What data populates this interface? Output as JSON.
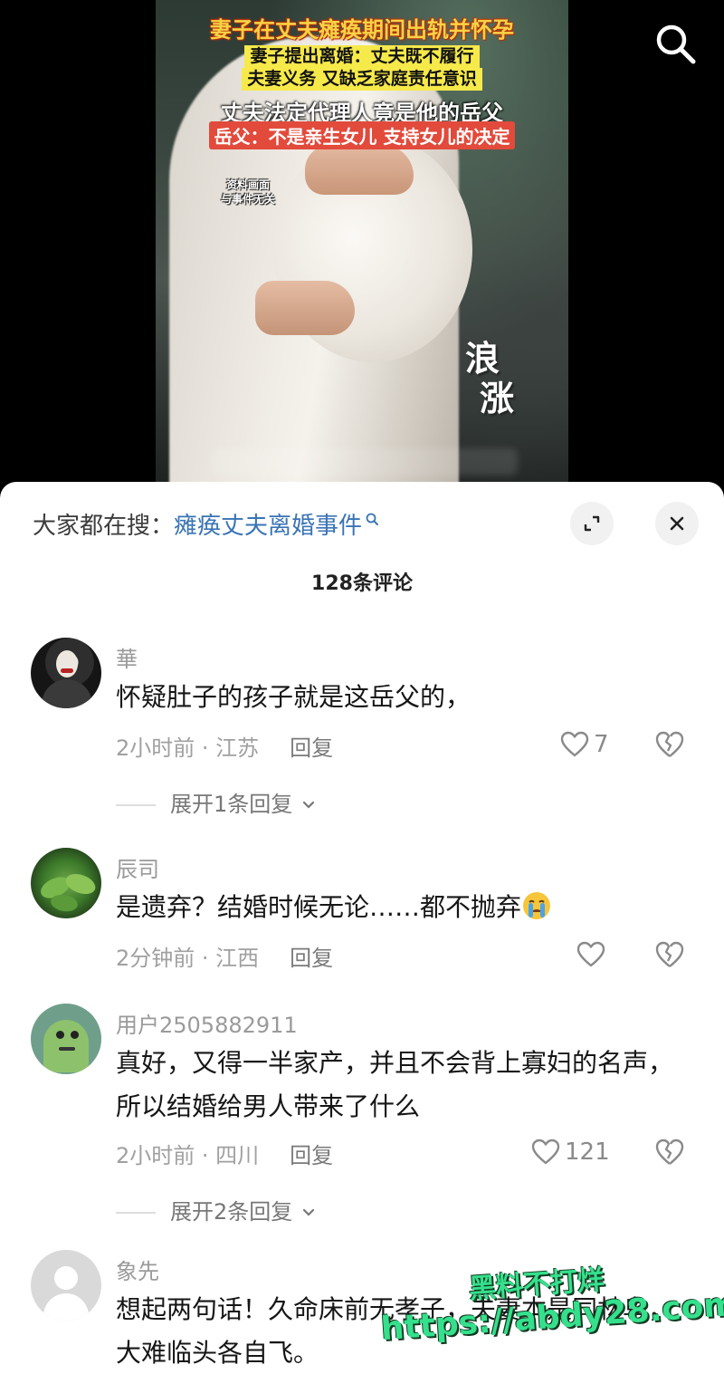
{
  "video": {
    "caption_line1": "妻子在丈夫瘫痪期间出轨并怀孕",
    "caption_line2a": "妻子提出离婚：丈夫既不履行",
    "caption_line2b": "夫妻义务 又缺乏家庭责任意识",
    "caption_line3": "丈夫法定代理人竟是他的岳父",
    "caption_line4": "岳父：不是亲生女儿 支持女儿的决定",
    "note_line1": "资料画面",
    "note_line2": "与事件无关",
    "logo_char1": "浪",
    "logo_char2": "涨",
    "search_icon": "search-icon"
  },
  "sheet": {
    "trending_prefix": "大家都在搜：",
    "trending_link": "瘫痪丈夫离婚事件",
    "comment_count": "128条评论"
  },
  "comments": [
    {
      "username": "華",
      "text": "怀疑肚子的孩子就是这岳父的，",
      "time": "2小时前",
      "location": "江苏",
      "reply_label": "回复",
      "likes": "7",
      "expand_label": "展开1条回复"
    },
    {
      "username": "辰司",
      "text": "是遗弃？结婚时候无论……都不抛弃",
      "time": "2分钟前",
      "location": "江西",
      "reply_label": "回复",
      "likes": ""
    },
    {
      "username": "用户2505882911",
      "text": "真好，又得一半家产，并且不会背上寡妇的名声，所以结婚给男人带来了什么",
      "time": "2小时前",
      "location": "四川",
      "reply_label": "回复",
      "likes": "121",
      "expand_label": "展开2条回复"
    },
    {
      "username": "象先",
      "text": "想起两句话！久命床前无孝子，夫妻本是同林鸟，大难临头各自飞。"
    }
  ],
  "watermark": {
    "line1": "黑料不打烊",
    "line2": "https://abdy28.com"
  },
  "colors": {
    "accent_link": "#3a74b5",
    "caption_yellow": "#f6e94a",
    "caption_red": "#e24a3b",
    "watermark_green": "#35e08c"
  }
}
